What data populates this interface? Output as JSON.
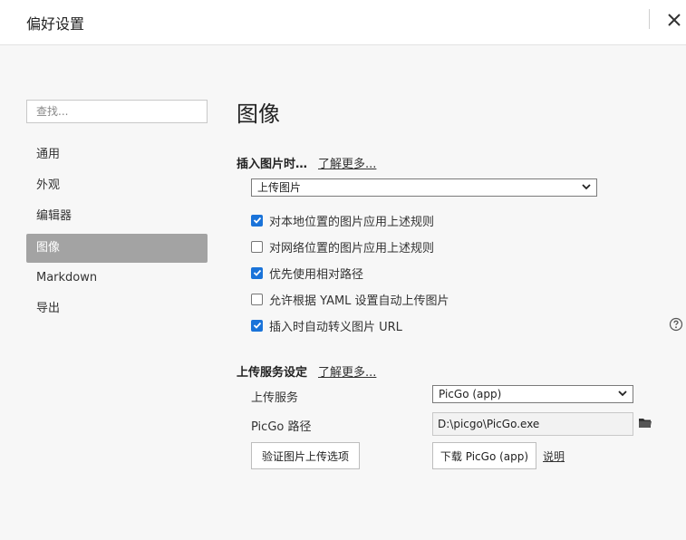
{
  "window": {
    "title": "偏好设置"
  },
  "search": {
    "placeholder": "查找..."
  },
  "sidebar": {
    "items": [
      {
        "label": "通用"
      },
      {
        "label": "外观"
      },
      {
        "label": "编辑器"
      },
      {
        "label": "图像",
        "active": true
      },
      {
        "label": "Markdown"
      },
      {
        "label": "导出"
      }
    ]
  },
  "main": {
    "heading": "图像",
    "insert": {
      "label": "插入图片时…",
      "learn_more": "了解更多...",
      "select_value": "上传图片",
      "checkboxes": [
        {
          "label": "对本地位置的图片应用上述规则",
          "checked": true
        },
        {
          "label": "对网络位置的图片应用上述规则",
          "checked": false
        },
        {
          "label": "优先使用相对路径",
          "checked": true
        },
        {
          "label": "允许根据 YAML 设置自动上传图片",
          "checked": false
        },
        {
          "label": "插入时自动转义图片 URL",
          "checked": true
        }
      ]
    },
    "upload": {
      "label": "上传服务设定",
      "learn_more": "了解更多...",
      "service_label": "上传服务",
      "service_value": "PicGo (app)",
      "path_label": "PicGo 路径",
      "path_value": "D:\\picgo\\PicGo.exe",
      "verify_button": "验证图片上传选项",
      "download_button": "下载 PicGo (app)",
      "explain_link": "说明"
    }
  },
  "colors": {
    "accent": "#1a73d9",
    "active_nav": "#a3a3a3"
  },
  "icons": {
    "close": "close-icon",
    "help": "help-icon",
    "folder": "folder-icon",
    "dropdown": "chevron-down-icon"
  }
}
